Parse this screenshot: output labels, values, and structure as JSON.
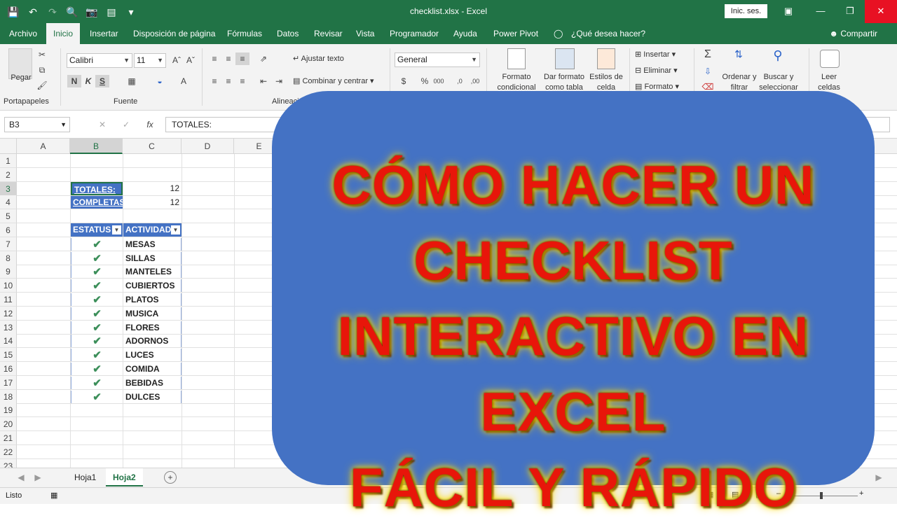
{
  "window": {
    "title": "checklist.xlsx - Excel",
    "signin": "Inic. ses."
  },
  "menu": {
    "tabs": [
      "Archivo",
      "Inicio",
      "Insertar",
      "Disposición de página",
      "Fórmulas",
      "Datos",
      "Revisar",
      "Vista",
      "Programador",
      "Ayuda",
      "Power Pivot"
    ],
    "tellme": "¿Qué desea hacer?",
    "share": "Compartir"
  },
  "ribbon": {
    "clipboard": {
      "paste": "Pegar",
      "label": "Portapapeles"
    },
    "font": {
      "name": "Calibri",
      "size": "11",
      "bold": "N",
      "italic": "K",
      "underline": "S",
      "label": "Fuente"
    },
    "alignment": {
      "wrap": "Ajustar texto",
      "merge": "Combinar y centrar",
      "label": "Alineació"
    },
    "number": {
      "format": "General"
    },
    "styles": {
      "conditional": "Formato condicional",
      "table": "Dar formato como tabla",
      "cell": "Estilos de celda"
    },
    "cells": {
      "insert": "Insertar",
      "delete": "Eliminar",
      "format": "Formato"
    },
    "editing": {
      "sort": "Ordenar y filtrar",
      "find": "Buscar y seleccionar"
    },
    "read": {
      "label": "Leer celdas"
    }
  },
  "formula_bar": {
    "name_box": "B3",
    "content": "TOTALES:"
  },
  "columns": [
    "A",
    "B",
    "C",
    "D",
    "E"
  ],
  "rows": [
    "1",
    "2",
    "3",
    "4",
    "5",
    "6",
    "7",
    "8",
    "9",
    "10",
    "11",
    "12",
    "13",
    "14",
    "15",
    "16",
    "17",
    "18",
    "19",
    "20",
    "21",
    "22",
    "23"
  ],
  "summary": {
    "totales_label": "TOTALES:",
    "totales_value": "12",
    "completas_label": "COMPLETAS:",
    "completas_value": "12"
  },
  "table": {
    "headers": [
      "ESTATUS",
      "ACTIVIDAD"
    ],
    "check_symbol": "✔",
    "items": [
      "MESAS",
      "SILLAS",
      "MANTELES",
      "CUBIERTOS",
      "PLATOS",
      "MUSICA",
      "FLORES",
      "ADORNOS",
      "LUCES",
      "COMIDA",
      "BEBIDAS",
      "DULCES"
    ]
  },
  "sheets": {
    "tabs": [
      "Hoja1",
      "Hoja2"
    ]
  },
  "status": {
    "text": "Listo"
  },
  "overlay": {
    "lines": [
      "CÓMO HACER UN",
      "CHECKLIST",
      "INTERACTIVO EN EXCEL",
      "FÁCIL Y RÁPIDO"
    ]
  },
  "colors": {
    "excel_green": "#217346",
    "table_blue": "#4472c4",
    "overlay_blue": "#4472c4",
    "title_red": "#e8160a"
  }
}
